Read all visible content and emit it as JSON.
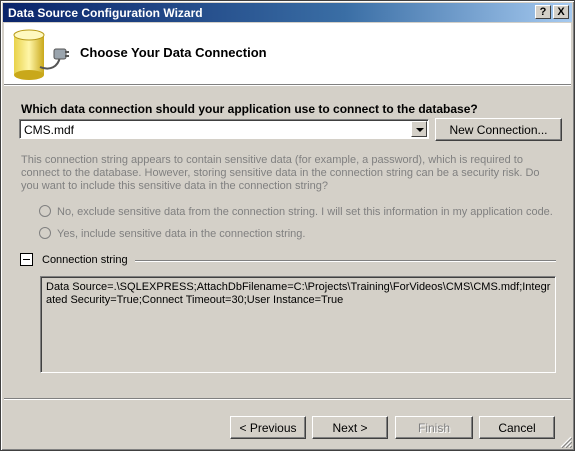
{
  "window": {
    "title": "Data Source Configuration Wizard"
  },
  "title_buttons": {
    "help": "?",
    "close": "X"
  },
  "header": {
    "title": "Choose Your Data Connection",
    "icon": "database-plug-icon"
  },
  "connection": {
    "question": "Which data connection should your application use to connect to the database?",
    "selected": "CMS.mdf",
    "new_connection_label": "New Connection..."
  },
  "sensitive": {
    "text": "This connection string appears to contain sensitive data (for example, a password), which is required to connect to the database. However, storing sensitive data in the connection string can be a security risk. Do you want to include this sensitive data in the connection string?",
    "option_no": "No, exclude sensitive data from the connection string. I will set this information in my application code.",
    "option_yes": "Yes, include sensitive data in the connection string."
  },
  "connection_string": {
    "label": "Connection string",
    "value": "Data Source=.\\SQLEXPRESS;AttachDbFilename=C:\\Projects\\Training\\ForVideos\\CMS\\CMS.mdf;Integrated Security=True;Connect Timeout=30;User Instance=True"
  },
  "footer": {
    "previous": "< Previous",
    "next": "Next >",
    "finish": "Finish",
    "cancel": "Cancel"
  },
  "colors": {
    "titlebar_start": "#0a246a",
    "titlebar_end": "#a6caf0",
    "face": "#d4d0c8",
    "disabled_text": "#808080"
  }
}
